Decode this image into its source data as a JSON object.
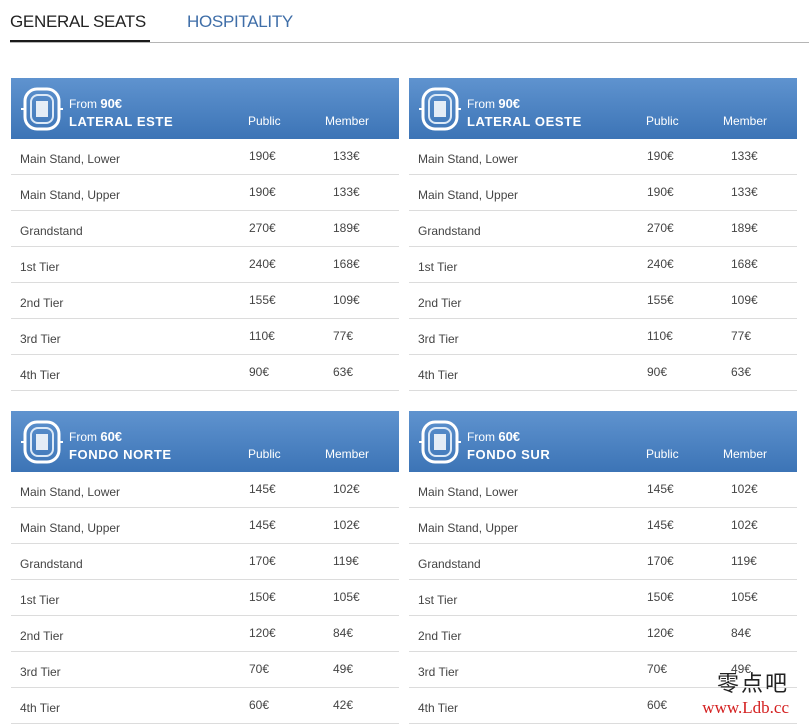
{
  "tabs": {
    "general": "GENERAL SEATS",
    "hospitality": "HOSPITALITY"
  },
  "columns": {
    "public": "Public",
    "member": "Member"
  },
  "from_label": "From",
  "cards": [
    {
      "price_from": "90€",
      "zone": "LATERAL ESTE",
      "rows": [
        {
          "label": "Main Stand, Lower",
          "public": "190€",
          "member": "133€"
        },
        {
          "label": "Main Stand, Upper",
          "public": "190€",
          "member": "133€"
        },
        {
          "label": "Grandstand",
          "public": "270€",
          "member": "189€"
        },
        {
          "label": "1st Tier",
          "public": "240€",
          "member": "168€"
        },
        {
          "label": "2nd Tier",
          "public": "155€",
          "member": "109€"
        },
        {
          "label": "3rd Tier",
          "public": "110€",
          "member": "77€"
        },
        {
          "label": "4th Tier",
          "public": "90€",
          "member": "63€"
        }
      ]
    },
    {
      "price_from": "90€",
      "zone": "LATERAL OESTE",
      "rows": [
        {
          "label": "Main Stand, Lower",
          "public": "190€",
          "member": "133€"
        },
        {
          "label": "Main Stand, Upper",
          "public": "190€",
          "member": "133€"
        },
        {
          "label": "Grandstand",
          "public": "270€",
          "member": "189€"
        },
        {
          "label": "1st Tier",
          "public": "240€",
          "member": "168€"
        },
        {
          "label": "2nd Tier",
          "public": "155€",
          "member": "109€"
        },
        {
          "label": "3rd Tier",
          "public": "110€",
          "member": "77€"
        },
        {
          "label": "4th Tier",
          "public": "90€",
          "member": "63€"
        }
      ]
    },
    {
      "price_from": "60€",
      "zone": "FONDO NORTE",
      "rows": [
        {
          "label": "Main Stand, Lower",
          "public": "145€",
          "member": "102€"
        },
        {
          "label": "Main Stand, Upper",
          "public": "145€",
          "member": "102€"
        },
        {
          "label": "Grandstand",
          "public": "170€",
          "member": "119€"
        },
        {
          "label": "1st Tier",
          "public": "150€",
          "member": "105€"
        },
        {
          "label": "2nd Tier",
          "public": "120€",
          "member": "84€"
        },
        {
          "label": "3rd Tier",
          "public": "70€",
          "member": "49€"
        },
        {
          "label": "4th Tier",
          "public": "60€",
          "member": "42€"
        }
      ]
    },
    {
      "price_from": "60€",
      "zone": "FONDO SUR",
      "rows": [
        {
          "label": "Main Stand, Lower",
          "public": "145€",
          "member": "102€"
        },
        {
          "label": "Main Stand, Upper",
          "public": "145€",
          "member": "102€"
        },
        {
          "label": "Grandstand",
          "public": "170€",
          "member": "119€"
        },
        {
          "label": "1st Tier",
          "public": "150€",
          "member": "105€"
        },
        {
          "label": "2nd Tier",
          "public": "120€",
          "member": "84€"
        },
        {
          "label": "3rd Tier",
          "public": "70€",
          "member": "49€"
        },
        {
          "label": "4th Tier",
          "public": "60€",
          "member": ""
        }
      ]
    }
  ],
  "watermark": {
    "cn": "零点吧",
    "url": "www.Ldb.cc"
  },
  "colors": {
    "header_top": "#5f93cf",
    "header_bottom": "#3c74b6",
    "tab_inactive": "#3f6ea8"
  }
}
